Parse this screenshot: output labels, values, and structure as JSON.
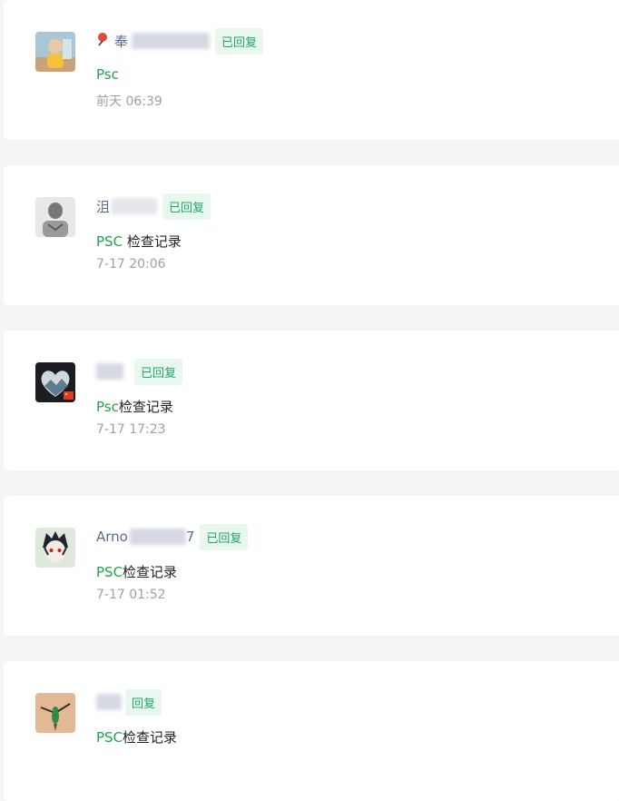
{
  "items": [
    {
      "name_prefix": "奉",
      "badge": "已回复",
      "msg_kw": "Psc",
      "msg_rest": "",
      "time": "前天 06:39"
    },
    {
      "name_prefix": "沮",
      "badge": "已回复",
      "msg_kw": "PSC",
      "msg_rest": " 检查记录",
      "time": "7-17 20:06"
    },
    {
      "name_prefix": "",
      "badge": "已回复",
      "msg_kw": "Psc",
      "msg_rest": "检查记录",
      "time": "7-17 17:23"
    },
    {
      "name_prefix": "Arno",
      "name_suffix": "7",
      "badge": "已回复",
      "msg_kw": "PSC",
      "msg_rest": "检查记录",
      "time": "7-17 01:52"
    },
    {
      "name_prefix": "",
      "badge": "回复",
      "msg_kw": "PSC",
      "msg_rest": "检查记录",
      "time": ""
    }
  ],
  "colors": {
    "keyword": "#20a24c",
    "badge_bg": "#e8f8ee",
    "badge_text": "#22a36b",
    "name": "#576b95",
    "time": "#a0a0a0"
  }
}
